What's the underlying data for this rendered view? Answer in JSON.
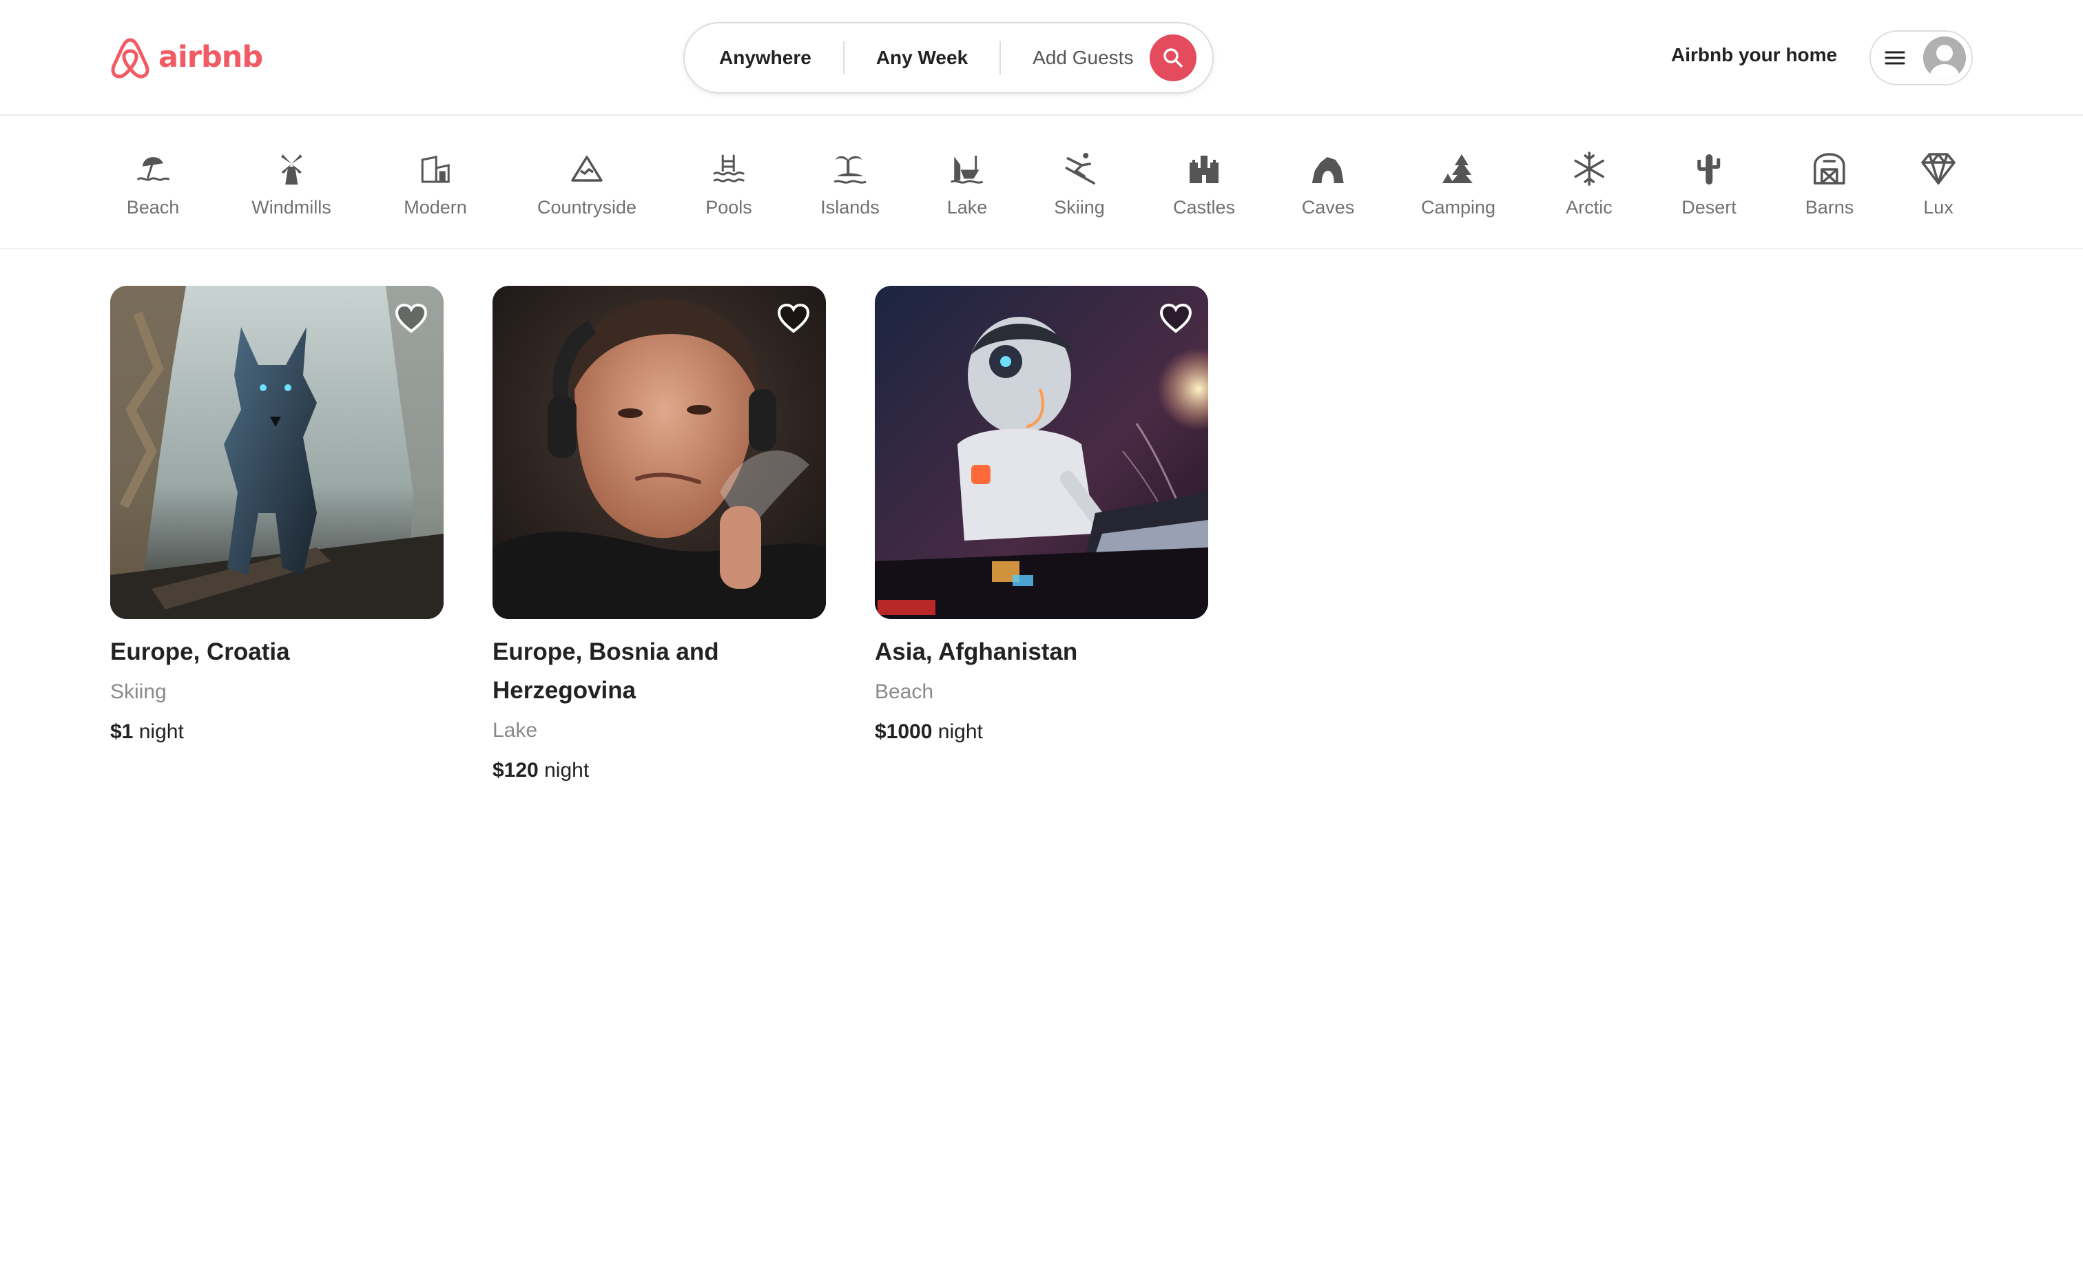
{
  "brand": {
    "name": "airbnb",
    "color": "#f15b63"
  },
  "search": {
    "where": "Anywhere",
    "when": "Any Week",
    "guests": "Add Guests",
    "button_icon": "search-icon",
    "button_color": "#e44b5d"
  },
  "header": {
    "host_link": "Airbnb your home",
    "menu_icon": "hamburger-icon",
    "avatar_icon": "user-avatar-icon"
  },
  "categories": [
    {
      "label": "Beach",
      "icon": "beach-icon"
    },
    {
      "label": "Windmills",
      "icon": "windmill-icon"
    },
    {
      "label": "Modern",
      "icon": "modern-house-icon"
    },
    {
      "label": "Countryside",
      "icon": "mountain-icon"
    },
    {
      "label": "Pools",
      "icon": "pool-icon"
    },
    {
      "label": "Islands",
      "icon": "island-icon"
    },
    {
      "label": "Lake",
      "icon": "lake-icon"
    },
    {
      "label": "Skiing",
      "icon": "skier-icon"
    },
    {
      "label": "Castles",
      "icon": "castle-icon"
    },
    {
      "label": "Caves",
      "icon": "cave-icon"
    },
    {
      "label": "Camping",
      "icon": "camping-icon"
    },
    {
      "label": "Arctic",
      "icon": "snowflake-icon"
    },
    {
      "label": "Desert",
      "icon": "cactus-icon"
    },
    {
      "label": "Barns",
      "icon": "barn-icon"
    },
    {
      "label": "Lux",
      "icon": "diamond-icon"
    }
  ],
  "listings": [
    {
      "location": "Europe, Croatia",
      "category": "Skiing",
      "price": "$1",
      "price_unit": "night",
      "image": "wolf-illustration"
    },
    {
      "location": "Europe, Bosnia and Herzegovina",
      "category": "Lake",
      "price": "$120",
      "price_unit": "night",
      "image": "man-portrait-photo"
    },
    {
      "location": "Asia, Afghanistan",
      "category": "Beach",
      "price": "$1000",
      "price_unit": "night",
      "image": "robot-illustration"
    }
  ]
}
